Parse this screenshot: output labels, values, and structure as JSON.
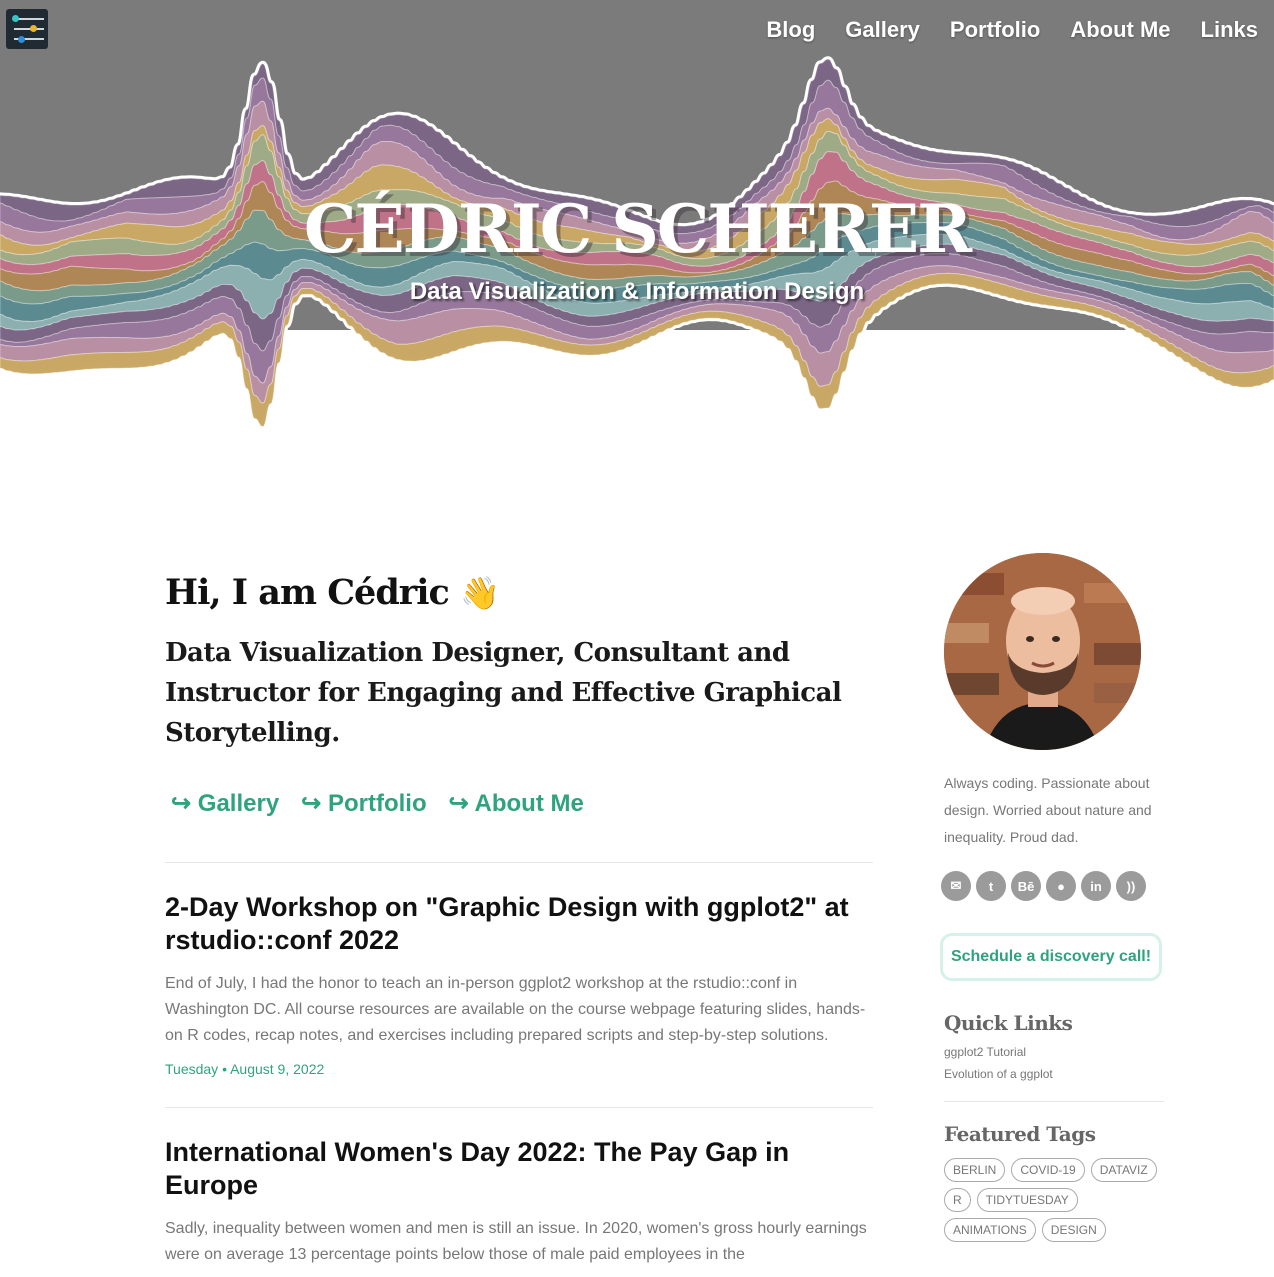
{
  "nav": {
    "items": [
      "Blog",
      "Gallery",
      "Portfolio",
      "About Me",
      "Links"
    ]
  },
  "hero": {
    "title": "CÉDRIC SCHERER",
    "subtitle": "Data Visualization & Information Design"
  },
  "intro": {
    "greeting": "Hi, I am Cédric",
    "wave": "👋",
    "tagline": "Data Visualization Designer, Consultant and Instructor for Engaging and Effective Graphical Storytelling.",
    "links": [
      "Gallery",
      "Portfolio",
      "About Me"
    ],
    "arrow": "↪"
  },
  "posts": [
    {
      "title": "2-Day Workshop on \"Graphic Design with ggplot2\" at rstudio::conf 2022",
      "excerpt": "End of July, I had the honor to teach an in-person ggplot2 workshop at the rstudio::conf in Washington DC. All course resources are available on the course webpage featuring slides, hands-on R codes, recap notes, and exercises including prepared scripts and step-by-step solutions.",
      "date": "Tuesday • August 9, 2022"
    },
    {
      "title": "International Women's Day 2022: The Pay Gap in Europe",
      "excerpt": "Sadly, inequality between women and men is still an issue. In 2020, women's gross hourly earnings were on average 13 percentage points below those of male paid employees in the",
      "date": ""
    }
  ],
  "sidebar": {
    "bio": "Always coding. Passionate about design. Worried about nature and inequality. Proud dad.",
    "social": [
      {
        "icon": "email-icon",
        "glyph": "✉"
      },
      {
        "icon": "twitter-icon",
        "glyph": "t"
      },
      {
        "icon": "behance-icon",
        "glyph": "Bē"
      },
      {
        "icon": "github-icon",
        "glyph": "●"
      },
      {
        "icon": "linkedin-icon",
        "glyph": "in"
      },
      {
        "icon": "rss-icon",
        "glyph": "))"
      }
    ],
    "cta": "Schedule a discovery call!",
    "quick_links_heading": "Quick Links",
    "quick_links": [
      "ggplot2 Tutorial",
      "Evolution of a ggplot"
    ],
    "tags_heading": "Featured Tags",
    "tags": [
      "BERLIN",
      "COVID-19",
      "DATAVIZ",
      "R",
      "TIDYTUESDAY",
      "ANIMATIONS",
      "DESIGN"
    ]
  },
  "colors": {
    "accent": "#2fa37e",
    "hero_bg": "#7b7b7b",
    "stream_palette": [
      "#6e5679",
      "#8d6a92",
      "#b2849a",
      "#c4a055",
      "#96a37a",
      "#b9647c",
      "#a77a44",
      "#6d907e",
      "#4a7f86",
      "#81a7a8"
    ]
  }
}
